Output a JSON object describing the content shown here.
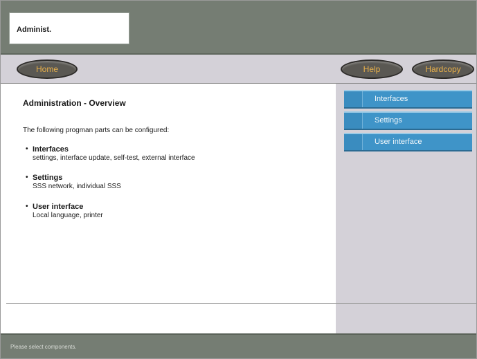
{
  "header": {
    "title": "Administ."
  },
  "nav": {
    "home": "Home",
    "help": "Help",
    "hardcopy": "Hardcopy"
  },
  "content": {
    "title": "Administration - Overview",
    "intro": "The following progman parts can be configured:",
    "items": [
      {
        "bullet": "•",
        "title": "Interfaces",
        "desc": "settings, interface update, self-test, external interface"
      },
      {
        "bullet": "•",
        "title": "Settings",
        "desc": "SSS network, individual SSS"
      },
      {
        "bullet": "•",
        "title": "User interface",
        "desc": "Local language, printer"
      }
    ]
  },
  "sidebar": {
    "buttons": [
      "Interfaces",
      "Settings",
      "User interface"
    ]
  },
  "status": {
    "text": "Please select components."
  }
}
